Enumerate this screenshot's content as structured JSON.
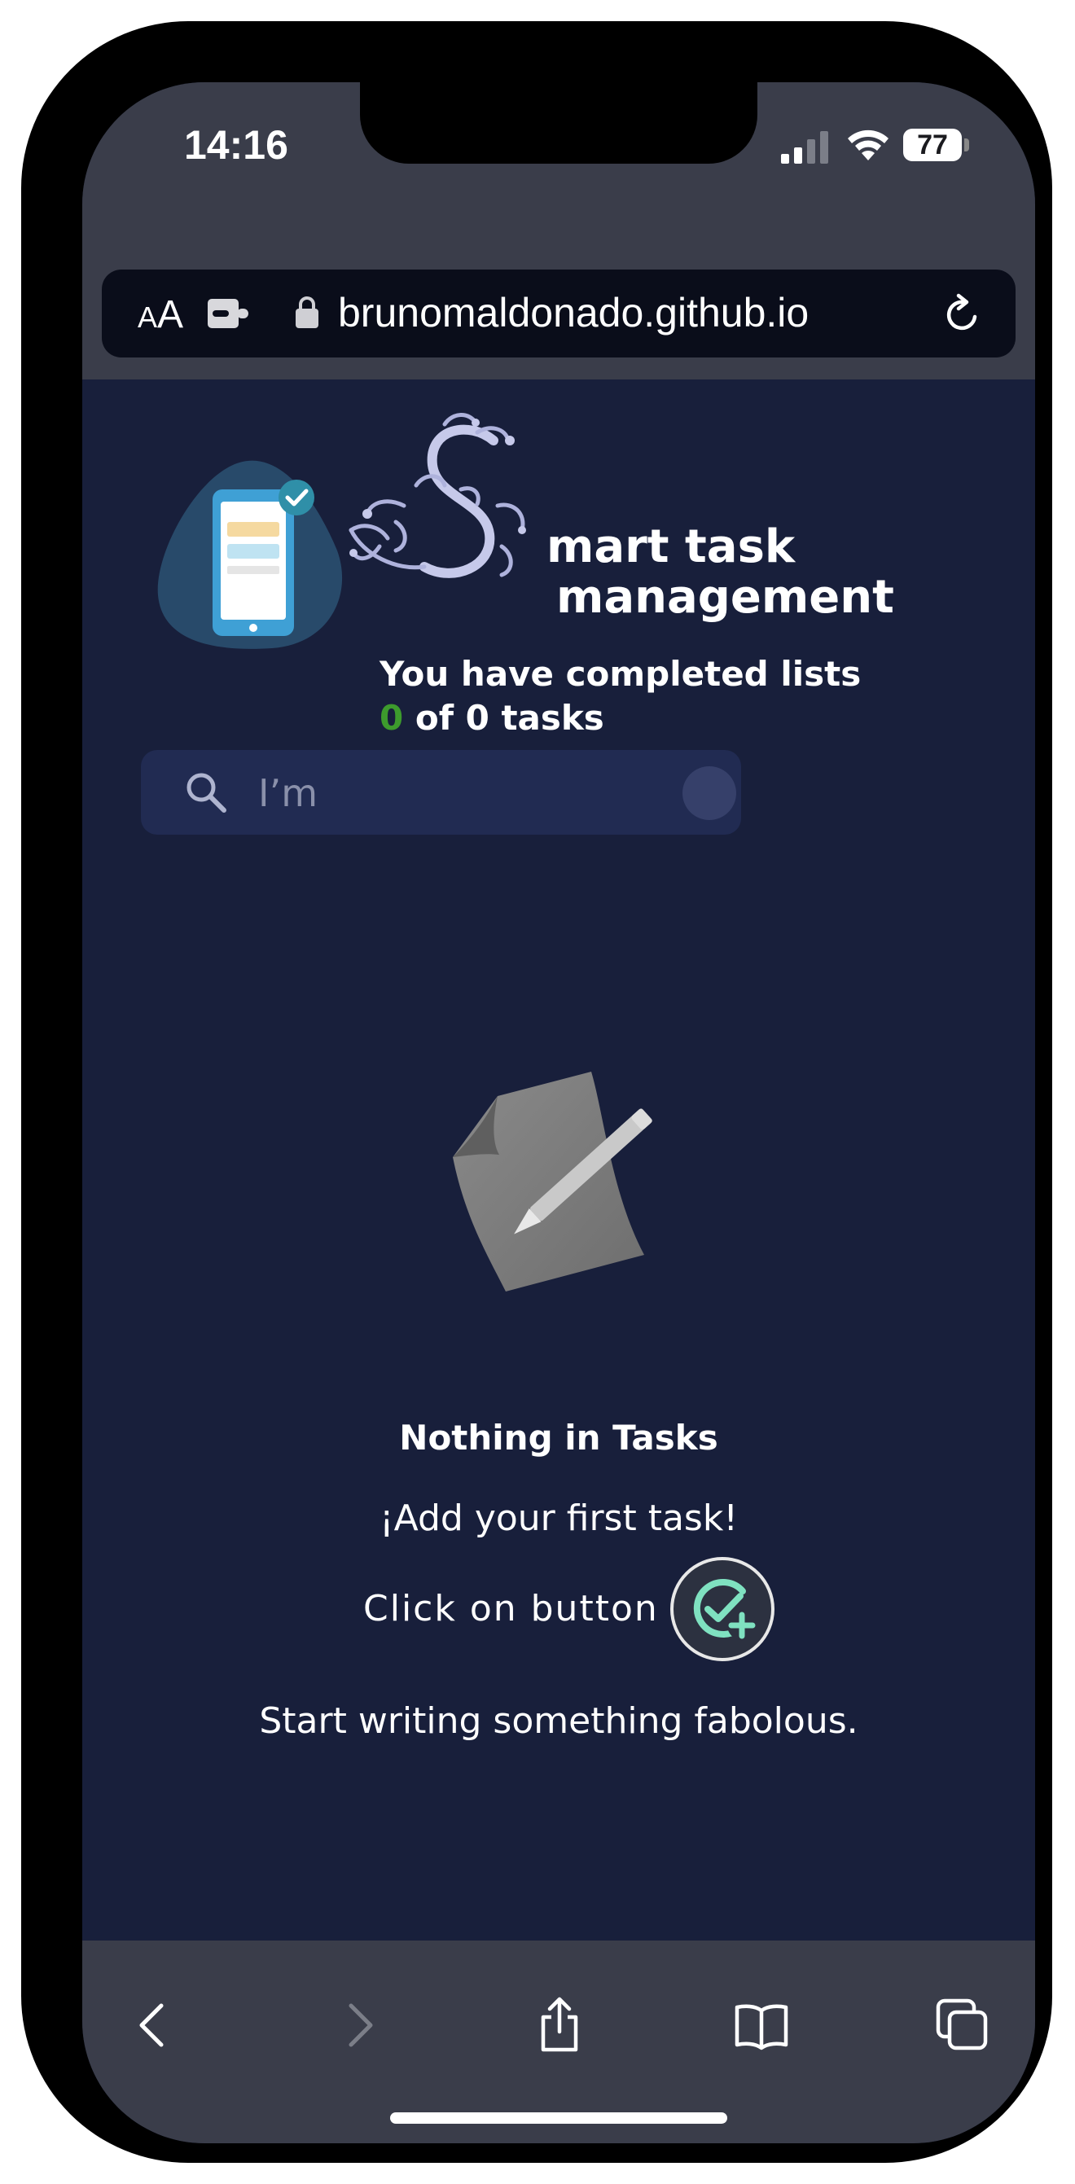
{
  "status_bar": {
    "time": "14:16",
    "battery": "77"
  },
  "browser": {
    "text_size_small": "A",
    "text_size_big": "A",
    "url": "brunomaldonado.github.io"
  },
  "app": {
    "title_line1": "mart task",
    "title_line2": "management",
    "subtitle_line1": "You have completed lists",
    "completed_count": "0",
    "subtitle_line2_rest": " of 0 tasks",
    "search_placeholder": "I’m"
  },
  "empty_state": {
    "title": "Nothing in Tasks",
    "line1": "¡Add your first task!",
    "click_text": "Click on button",
    "line3": "Start writing something fabolous."
  },
  "colors": {
    "background": "#181f3b",
    "browser_chrome": "#3a3d4a",
    "completed_count": "#3d9b2d",
    "button_accent": "#7fe1c0"
  },
  "icons": {
    "lock": "lock-icon",
    "reload": "reload-icon",
    "search": "search-icon",
    "add_task": "add-task-icon",
    "back": "back-icon",
    "forward": "forward-icon",
    "share": "share-icon",
    "bookmarks": "bookmarks-icon",
    "tabs": "tabs-icon"
  }
}
